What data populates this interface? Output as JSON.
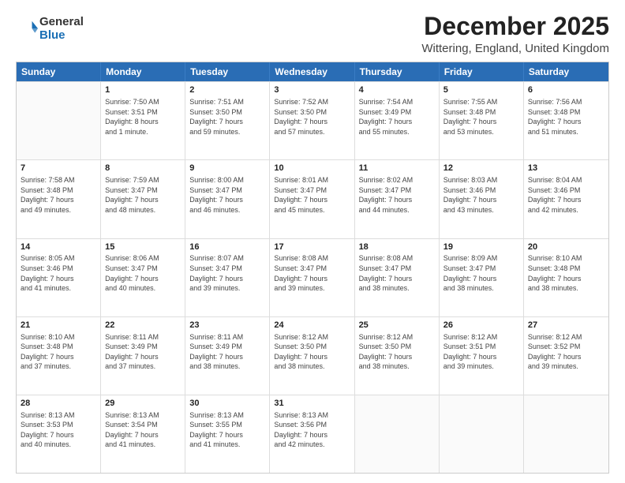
{
  "logo": {
    "general": "General",
    "blue": "Blue"
  },
  "title": "December 2025",
  "subtitle": "Wittering, England, United Kingdom",
  "days": [
    "Sunday",
    "Monday",
    "Tuesday",
    "Wednesday",
    "Thursday",
    "Friday",
    "Saturday"
  ],
  "weeks": [
    [
      {
        "day": "",
        "info": ""
      },
      {
        "day": "1",
        "info": "Sunrise: 7:50 AM\nSunset: 3:51 PM\nDaylight: 8 hours\nand 1 minute."
      },
      {
        "day": "2",
        "info": "Sunrise: 7:51 AM\nSunset: 3:50 PM\nDaylight: 7 hours\nand 59 minutes."
      },
      {
        "day": "3",
        "info": "Sunrise: 7:52 AM\nSunset: 3:50 PM\nDaylight: 7 hours\nand 57 minutes."
      },
      {
        "day": "4",
        "info": "Sunrise: 7:54 AM\nSunset: 3:49 PM\nDaylight: 7 hours\nand 55 minutes."
      },
      {
        "day": "5",
        "info": "Sunrise: 7:55 AM\nSunset: 3:48 PM\nDaylight: 7 hours\nand 53 minutes."
      },
      {
        "day": "6",
        "info": "Sunrise: 7:56 AM\nSunset: 3:48 PM\nDaylight: 7 hours\nand 51 minutes."
      }
    ],
    [
      {
        "day": "7",
        "info": "Sunrise: 7:58 AM\nSunset: 3:48 PM\nDaylight: 7 hours\nand 49 minutes."
      },
      {
        "day": "8",
        "info": "Sunrise: 7:59 AM\nSunset: 3:47 PM\nDaylight: 7 hours\nand 48 minutes."
      },
      {
        "day": "9",
        "info": "Sunrise: 8:00 AM\nSunset: 3:47 PM\nDaylight: 7 hours\nand 46 minutes."
      },
      {
        "day": "10",
        "info": "Sunrise: 8:01 AM\nSunset: 3:47 PM\nDaylight: 7 hours\nand 45 minutes."
      },
      {
        "day": "11",
        "info": "Sunrise: 8:02 AM\nSunset: 3:47 PM\nDaylight: 7 hours\nand 44 minutes."
      },
      {
        "day": "12",
        "info": "Sunrise: 8:03 AM\nSunset: 3:46 PM\nDaylight: 7 hours\nand 43 minutes."
      },
      {
        "day": "13",
        "info": "Sunrise: 8:04 AM\nSunset: 3:46 PM\nDaylight: 7 hours\nand 42 minutes."
      }
    ],
    [
      {
        "day": "14",
        "info": "Sunrise: 8:05 AM\nSunset: 3:46 PM\nDaylight: 7 hours\nand 41 minutes."
      },
      {
        "day": "15",
        "info": "Sunrise: 8:06 AM\nSunset: 3:47 PM\nDaylight: 7 hours\nand 40 minutes."
      },
      {
        "day": "16",
        "info": "Sunrise: 8:07 AM\nSunset: 3:47 PM\nDaylight: 7 hours\nand 39 minutes."
      },
      {
        "day": "17",
        "info": "Sunrise: 8:08 AM\nSunset: 3:47 PM\nDaylight: 7 hours\nand 39 minutes."
      },
      {
        "day": "18",
        "info": "Sunrise: 8:08 AM\nSunset: 3:47 PM\nDaylight: 7 hours\nand 38 minutes."
      },
      {
        "day": "19",
        "info": "Sunrise: 8:09 AM\nSunset: 3:47 PM\nDaylight: 7 hours\nand 38 minutes."
      },
      {
        "day": "20",
        "info": "Sunrise: 8:10 AM\nSunset: 3:48 PM\nDaylight: 7 hours\nand 38 minutes."
      }
    ],
    [
      {
        "day": "21",
        "info": "Sunrise: 8:10 AM\nSunset: 3:48 PM\nDaylight: 7 hours\nand 37 minutes."
      },
      {
        "day": "22",
        "info": "Sunrise: 8:11 AM\nSunset: 3:49 PM\nDaylight: 7 hours\nand 37 minutes."
      },
      {
        "day": "23",
        "info": "Sunrise: 8:11 AM\nSunset: 3:49 PM\nDaylight: 7 hours\nand 38 minutes."
      },
      {
        "day": "24",
        "info": "Sunrise: 8:12 AM\nSunset: 3:50 PM\nDaylight: 7 hours\nand 38 minutes."
      },
      {
        "day": "25",
        "info": "Sunrise: 8:12 AM\nSunset: 3:50 PM\nDaylight: 7 hours\nand 38 minutes."
      },
      {
        "day": "26",
        "info": "Sunrise: 8:12 AM\nSunset: 3:51 PM\nDaylight: 7 hours\nand 39 minutes."
      },
      {
        "day": "27",
        "info": "Sunrise: 8:12 AM\nSunset: 3:52 PM\nDaylight: 7 hours\nand 39 minutes."
      }
    ],
    [
      {
        "day": "28",
        "info": "Sunrise: 8:13 AM\nSunset: 3:53 PM\nDaylight: 7 hours\nand 40 minutes."
      },
      {
        "day": "29",
        "info": "Sunrise: 8:13 AM\nSunset: 3:54 PM\nDaylight: 7 hours\nand 41 minutes."
      },
      {
        "day": "30",
        "info": "Sunrise: 8:13 AM\nSunset: 3:55 PM\nDaylight: 7 hours\nand 41 minutes."
      },
      {
        "day": "31",
        "info": "Sunrise: 8:13 AM\nSunset: 3:56 PM\nDaylight: 7 hours\nand 42 minutes."
      },
      {
        "day": "",
        "info": ""
      },
      {
        "day": "",
        "info": ""
      },
      {
        "day": "",
        "info": ""
      }
    ]
  ]
}
